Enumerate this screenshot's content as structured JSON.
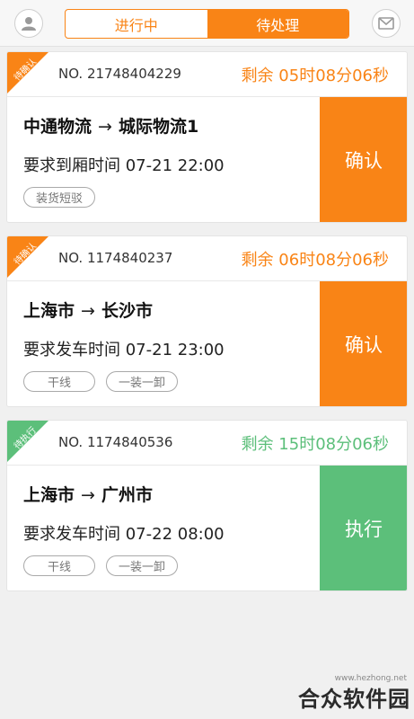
{
  "header": {
    "tabs": [
      {
        "label": "进行中",
        "active": false
      },
      {
        "label": "待处理",
        "active": true
      }
    ],
    "left_icon": "user-icon",
    "right_icon": "message-icon"
  },
  "orders": [
    {
      "status_tag": "待确认",
      "order_no": "NO. 21748404229",
      "remaining": "剩余 05时08分06秒",
      "origin": "中通物流",
      "destination": "城际物流1",
      "arrow": "→",
      "requirement": "要求到厢时间 07-21 22:00",
      "tags": [
        "装货短驳"
      ],
      "action_label": "确认",
      "accent": "#f98416"
    },
    {
      "status_tag": "待确认",
      "order_no": "NO. 1174840237",
      "remaining": "剩余 06时08分06秒",
      "origin": "上海市",
      "destination": "长沙市",
      "arrow": "→",
      "requirement": "要求发车时间 07-21 23:00",
      "tags": [
        "干线",
        "一装一卸"
      ],
      "action_label": "确认",
      "accent": "#f98416"
    },
    {
      "status_tag": "待执行",
      "order_no": "NO. 1174840536",
      "remaining": "剩余 15时08分06秒",
      "origin": "上海市",
      "destination": "广州市",
      "arrow": "→",
      "requirement": "要求发车时间 07-22 08:00",
      "tags": [
        "干线",
        "一装一卸"
      ],
      "action_label": "执行",
      "accent": "#5cbf7a"
    }
  ],
  "watermark": {
    "url": "www.hezhong.net",
    "name": "合众软件园"
  }
}
